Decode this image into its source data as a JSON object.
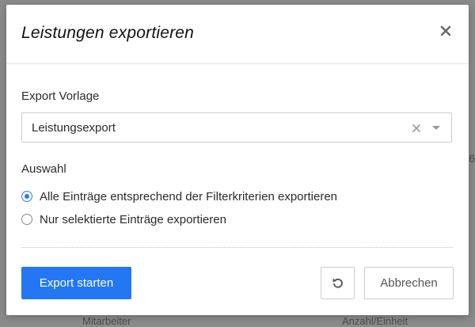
{
  "backdrop": {
    "left_text": "Mitarbeiter",
    "right_text": "Anzahl/Einheit",
    "edge_text": "6"
  },
  "dialog": {
    "title": "Leistungen exportieren",
    "close_icon": "close-icon",
    "template": {
      "label": "Export Vorlage",
      "value": "Leistungsexport",
      "clear_icon": "clear-icon",
      "dropdown_icon": "chevron-down-icon"
    },
    "selection": {
      "label": "Auswahl",
      "options": [
        {
          "label": "Alle Einträge entsprechend der Filterkriterien exportieren",
          "checked": true
        },
        {
          "label": "Nur selektierte Einträge exportieren",
          "checked": false
        }
      ]
    },
    "actions": {
      "start_label": "Export starten",
      "reset_icon": "reset-icon",
      "cancel_label": "Abbrechen"
    }
  },
  "colors": {
    "accent": "#2477f2",
    "radio_active": "#2b7de9",
    "backdrop": "#8a8a8a"
  }
}
